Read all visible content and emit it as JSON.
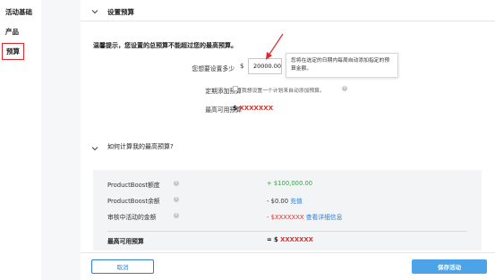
{
  "sidebar": {
    "items": [
      {
        "label": "活动基础"
      },
      {
        "label": "产品"
      },
      {
        "label": "预算",
        "active": true
      }
    ]
  },
  "section": {
    "title": "设置预算"
  },
  "warning": "温馨提示，您设置的总预算不能超过您的最高预算。",
  "budget": {
    "label": "您想要设置多少",
    "currency": "$",
    "value": "20000.00",
    "tooltip": "您将在选定的日期内每周自动添加指定的预算金额。"
  },
  "recurring": {
    "label": "定期添加预算",
    "checkbox_text": "我想设置一个计划来自动添加预算。"
  },
  "max_budget": {
    "label": "最高可用预算",
    "currency": "$",
    "value": "XXXXXXX"
  },
  "how": {
    "title": "如何计算我的最高预算?"
  },
  "calc": {
    "rows": [
      {
        "label": "ProductBoost额度",
        "prefix": "+ ",
        "value": "$100,000.00",
        "link": ""
      },
      {
        "label": "ProductBoost余额",
        "prefix": "- ",
        "value": "$0.00",
        "link": "充值"
      },
      {
        "label": "审核中活动的金额",
        "prefix": "- ",
        "value": "$XXXXXXX",
        "link": "查看详细信息"
      }
    ],
    "total_label": "最高可用预算",
    "total_prefix": "= $ ",
    "total_value": "XXXXXXX"
  },
  "footer": {
    "cancel_label": "取消",
    "save_label": "保存活动"
  },
  "colors": {
    "accent": "#2d7fd6",
    "save_button": "#4da3e8",
    "highlight_red": "#d6322e",
    "positive_green": "#3fa34d",
    "annotation_red": "#e02a2a"
  }
}
